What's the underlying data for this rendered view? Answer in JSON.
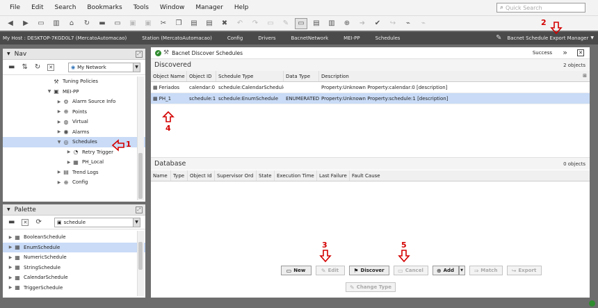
{
  "menu": [
    "File",
    "Edit",
    "Search",
    "Bookmarks",
    "Tools",
    "Window",
    "Manager",
    "Help"
  ],
  "search": {
    "placeholder": "Quick Search"
  },
  "breadcrumb": [
    "My Host : DESKTOP-7KGD0L7 (MercatoAutomacao)",
    "Station (MercatoAutomacao)",
    "Config",
    "Drivers",
    "BacnetNetwork",
    "MEI-PP",
    "Schedules"
  ],
  "view_selector": "Bacnet Schedule Export Manager",
  "nav": {
    "title": "Nav",
    "network_select": "My Network",
    "items": [
      {
        "label": "Tuning Policies",
        "icon": "wrench-icon"
      },
      {
        "label": "MEI-PP",
        "icon": "device-icon"
      },
      {
        "label": "Alarm Source Info",
        "icon": "gear-icon"
      },
      {
        "label": "Points",
        "icon": "points-icon"
      },
      {
        "label": "Virtual",
        "icon": "virtual-icon"
      },
      {
        "label": "Alarms",
        "icon": "alarm-icon"
      },
      {
        "label": "Schedules",
        "icon": "schedules-icon"
      },
      {
        "label": "Retry Trigger",
        "icon": "trigger-icon"
      },
      {
        "label": "PH_Local",
        "icon": "schedule-icon"
      },
      {
        "label": "Trend Logs",
        "icon": "trend-icon"
      },
      {
        "label": "Config",
        "icon": "config-icon"
      }
    ]
  },
  "palette": {
    "title": "Palette",
    "module_select": "schedule",
    "items": [
      "BooleanSchedule",
      "EnumSchedule",
      "NumericSchedule",
      "StringSchedule",
      "CalendarSchedule",
      "TriggerSchedule"
    ]
  },
  "main": {
    "title": "Bacnet Discover Schedules",
    "status": "Success",
    "discovered": {
      "header": "Discovered",
      "count": "2 objects",
      "columns": [
        "Object Name",
        "Object ID",
        "Schedule Type",
        "Data Type",
        "Description"
      ],
      "rows": [
        [
          "Feriados",
          "calendar:0",
          "schedule:CalendarSchedule",
          "",
          "Property:Unknown Property:calendar:0 [description]"
        ],
        [
          "PH_1",
          "schedule:1",
          "schedule:EnumSchedule",
          "ENUMERATED",
          "Property:Unknown Property:schedule:1 [description]"
        ]
      ]
    },
    "database": {
      "header": "Database",
      "count": "0 objects",
      "columns": [
        "Name",
        "Type",
        "Object Id",
        "Supervisor Ord",
        "State",
        "Execution Time",
        "Last Failure",
        "Fault Cause"
      ]
    },
    "buttons": {
      "new": "New",
      "edit": "Edit",
      "discover": "Discover",
      "cancel": "Cancel",
      "add": "Add",
      "match": "Match",
      "export": "Export",
      "change_type": "Change Type"
    }
  },
  "annotations": [
    "1",
    "2",
    "3",
    "4",
    "5"
  ],
  "colors": {
    "annotation": "#d40000",
    "selection": "#c9dbf6",
    "crumb_bg": "#4a4a4a"
  }
}
